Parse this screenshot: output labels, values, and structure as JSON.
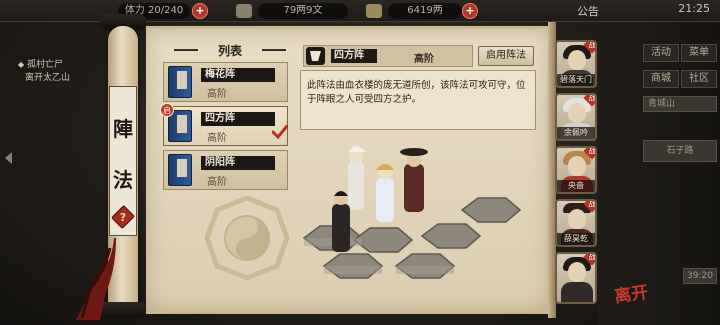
{
  "topbar": {
    "stamina": "20/240",
    "stamina_label": "体力",
    "silver": "79两9文",
    "gold": "6419两",
    "announcement": "公告",
    "time": "21:25"
  },
  "quest": {
    "title": "孤村亡尸",
    "subtitle": "离开太乙山"
  },
  "side_menu": {
    "activity": "活动",
    "menu": "菜单",
    "shop": "商城",
    "social": "社区",
    "location": "青城山",
    "road_button": "石子路",
    "value_chip": "39:20"
  },
  "scroll": {
    "title_chars": [
      "陣",
      "法"
    ],
    "help_label": "?"
  },
  "list": {
    "header": "列表",
    "items": [
      {
        "name": "梅花阵",
        "rank": "高阶",
        "enabled": false
      },
      {
        "name": "四方阵",
        "rank": "高阶",
        "enabled": true,
        "badge": "启"
      },
      {
        "name": "阴阳阵",
        "rank": "高阶",
        "enabled": false
      }
    ]
  },
  "detail": {
    "name": "四方阵",
    "rank": "高阶",
    "enable_button": "启用阵法",
    "description": "此阵法由血衣楼的庞无道所创，该阵法可攻可守，位于阵眼之人可受四方之护。"
  },
  "party": [
    {
      "name": "碧落天门",
      "badge": "战"
    },
    {
      "name": "余佩吟",
      "badge": "战"
    },
    {
      "name": "央啬",
      "badge": "战"
    },
    {
      "name": "薛昊乾",
      "badge": "战"
    },
    {
      "name": "",
      "badge": "战"
    }
  ],
  "logo_text": "离开",
  "colors": {
    "accent_red": "#b8321f",
    "paper": "#e2d5ba",
    "ink": "#1d1915"
  }
}
